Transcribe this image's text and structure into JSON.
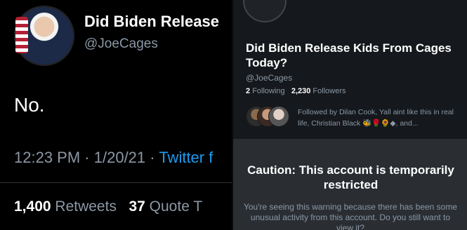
{
  "left": {
    "display_name": "Did Biden Release",
    "handle": "@JoeCages",
    "tweet_text": "No.",
    "time": "12:23 PM",
    "date": "1/20/21",
    "separator": "·",
    "source": "Twitter f",
    "retweets_count": "1,400",
    "retweets_label": "Retweets",
    "quotes_count": "37",
    "quotes_label": "Quote T"
  },
  "right": {
    "title": "Did Biden Release Kids From Cages Today?",
    "handle": "@JoeCages",
    "following_count": "2",
    "following_label": "Following",
    "followers_count": "2,230",
    "followers_label": "Followers",
    "followed_by": "Followed by Dilan Cook, Yall aint like this in real life, Christian Black 🐝🌹🌻◆, and...",
    "caution_title": "Caution: This account is temporarily restricted",
    "caution_body": "You're seeing this warning because there has been some unusual activity from this account. Do you still want to view it?"
  }
}
